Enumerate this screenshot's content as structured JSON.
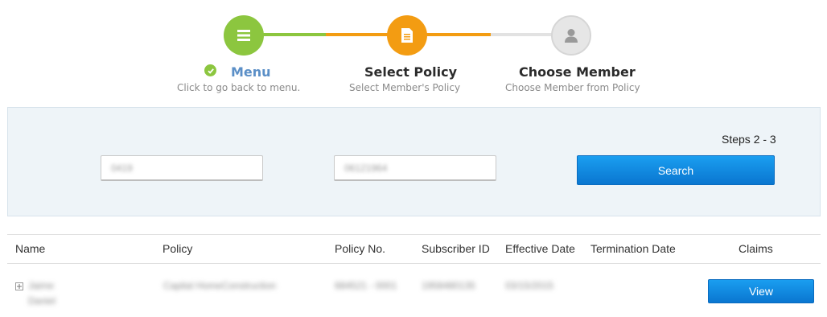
{
  "stepper": {
    "steps": [
      {
        "title": "Menu",
        "subtitle": "Click to go back to menu.",
        "icon": "menu-icon",
        "state": "completed",
        "color": "#8cc63f"
      },
      {
        "title": "Select Policy",
        "subtitle": "Select Member's Policy",
        "icon": "document-icon",
        "state": "active",
        "color": "#f39c12"
      },
      {
        "title": "Choose Member",
        "subtitle": "Choose Member from Policy",
        "icon": "user-icon",
        "state": "pending",
        "color": "#e6e6e6"
      }
    ]
  },
  "search": {
    "steps_label": "Steps 2 - 3",
    "field1_value": "0419",
    "field2_value": "06121964",
    "search_label": "Search",
    "button_color": "#0a84e0"
  },
  "table": {
    "columns": [
      "Name",
      "Policy",
      "Policy No.",
      "Subscriber ID",
      "Effective Date",
      "Termination Date",
      "Claims"
    ],
    "rows": [
      {
        "first_name": "Jaime",
        "last_name": "Daniel",
        "policy": "Capital HomeConstruction",
        "policy_no": "684521 - 0001",
        "subscriber_id": "1958480135",
        "effective_date": "03/15/2015",
        "termination_date": "",
        "claims_label": "View"
      }
    ]
  }
}
